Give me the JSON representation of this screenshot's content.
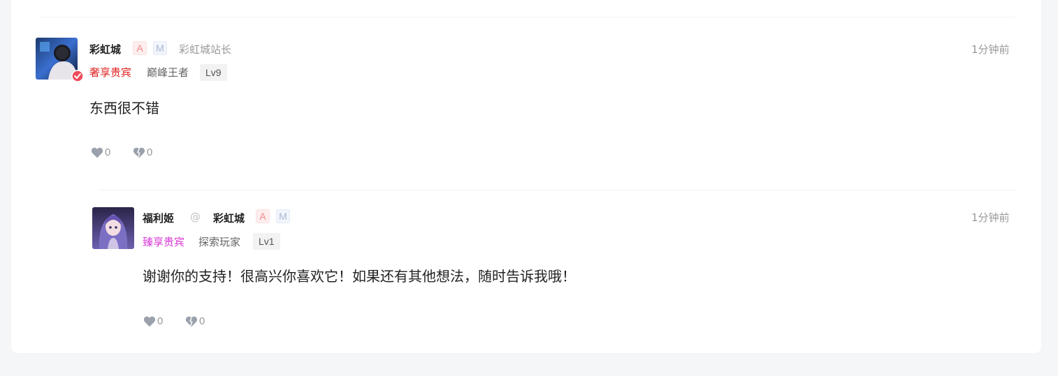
{
  "comments": [
    {
      "author": "彩虹城",
      "badge_a": "A",
      "badge_m": "M",
      "title": "彩虹城站长",
      "vip": "奢享贵宾",
      "vip_color": "#e02020",
      "rank": "巅峰王者",
      "level": "Lv9",
      "time": "1分钟前",
      "content": "东西很不错",
      "likes": "0",
      "dislikes": "0",
      "verified_icon": "verified-check-icon"
    },
    {
      "author": "福利姬",
      "at_symbol": "@",
      "reply_to": "彩虹城",
      "badge_a": "A",
      "badge_m": "M",
      "vip": "臻享贵宾",
      "vip_color": "#d63ad6",
      "rank": "探索玩家",
      "level": "Lv1",
      "time": "1分钟前",
      "content": "谢谢你的支持！很高兴你喜欢它！如果还有其他想法，随时告诉我哦！",
      "likes": "0",
      "dislikes": "0"
    }
  ],
  "colors": {
    "icon_gray": "#9aa1ac",
    "verified_red": "#ef4b5b"
  }
}
